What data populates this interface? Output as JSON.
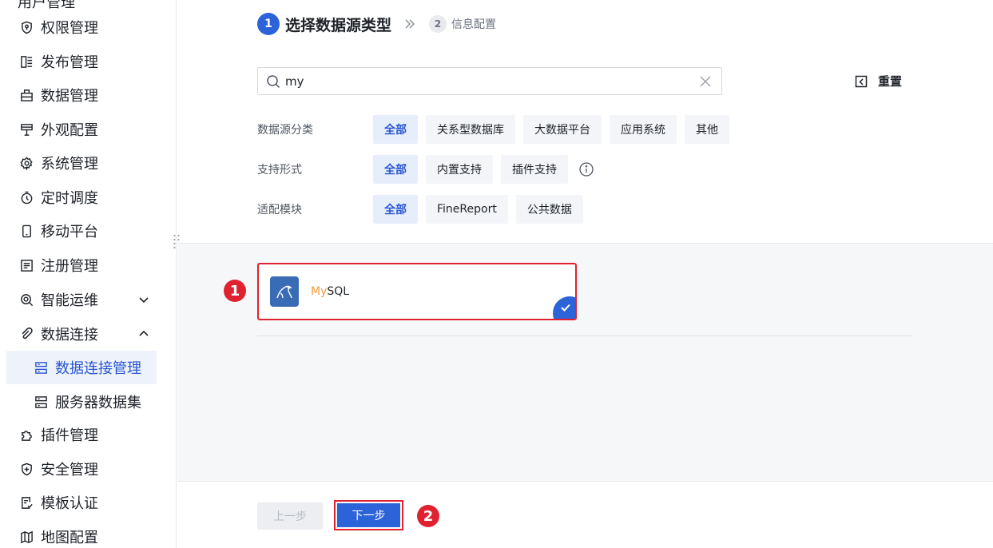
{
  "sidebar": {
    "top_cut_label": "用户管理",
    "items": [
      {
        "label": "权限管理",
        "icon": "shield-key-icon"
      },
      {
        "label": "发布管理",
        "icon": "publish-icon"
      },
      {
        "label": "数据管理",
        "icon": "database-box-icon"
      },
      {
        "label": "外观配置",
        "icon": "appearance-icon"
      },
      {
        "label": "系统管理",
        "icon": "gear-icon"
      },
      {
        "label": "定时调度",
        "icon": "timer-icon"
      },
      {
        "label": "移动平台",
        "icon": "mobile-icon"
      },
      {
        "label": "注册管理",
        "icon": "register-icon"
      },
      {
        "label": "智能运维",
        "icon": "ops-icon"
      },
      {
        "label": "数据连接",
        "icon": "link-icon"
      },
      {
        "label": "数据连接管理",
        "icon": "connection-manage-icon"
      },
      {
        "label": "服务器数据集",
        "icon": "server-dataset-icon"
      },
      {
        "label": "插件管理",
        "icon": "plugin-icon"
      },
      {
        "label": "安全管理",
        "icon": "security-icon"
      },
      {
        "label": "模板认证",
        "icon": "template-cert-icon"
      },
      {
        "label": "地图配置",
        "icon": "map-icon"
      }
    ]
  },
  "steps": {
    "step1_num": "1",
    "step1_label": "选择数据源类型",
    "step2_num": "2",
    "step2_label": "信息配置"
  },
  "search": {
    "value": "my"
  },
  "reset_label": "重置",
  "filters": {
    "category_label": "数据源分类",
    "category_options": [
      "全部",
      "关系型数据库",
      "大数据平台",
      "应用系统",
      "其他"
    ],
    "support_label": "支持形式",
    "support_options": [
      "全部",
      "内置支持",
      "插件支持"
    ],
    "module_label": "适配模块",
    "module_options": [
      "全部",
      "FineReport",
      "公共数据"
    ],
    "selected": "全部"
  },
  "result_card": {
    "highlight": "My",
    "rest": "SQL",
    "selected": true
  },
  "badges": {
    "one": "1",
    "two": "2"
  },
  "footer": {
    "prev_label": "上一步",
    "next_label": "下一步"
  },
  "colors": {
    "accent": "#2d63d8",
    "highlight_red": "#e0212f",
    "match_orange": "#f29a3a"
  }
}
